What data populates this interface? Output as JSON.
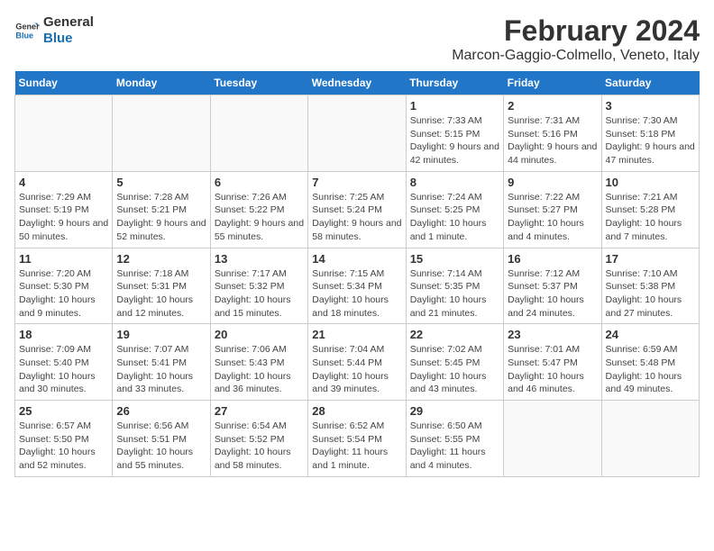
{
  "header": {
    "logo_line1": "General",
    "logo_line2": "Blue",
    "title": "February 2024",
    "subtitle": "Marcon-Gaggio-Colmello, Veneto, Italy"
  },
  "weekdays": [
    "Sunday",
    "Monday",
    "Tuesday",
    "Wednesday",
    "Thursday",
    "Friday",
    "Saturday"
  ],
  "weeks": [
    [
      {
        "day": "",
        "info": ""
      },
      {
        "day": "",
        "info": ""
      },
      {
        "day": "",
        "info": ""
      },
      {
        "day": "",
        "info": ""
      },
      {
        "day": "1",
        "info": "Sunrise: 7:33 AM\nSunset: 5:15 PM\nDaylight: 9 hours and 42 minutes."
      },
      {
        "day": "2",
        "info": "Sunrise: 7:31 AM\nSunset: 5:16 PM\nDaylight: 9 hours and 44 minutes."
      },
      {
        "day": "3",
        "info": "Sunrise: 7:30 AM\nSunset: 5:18 PM\nDaylight: 9 hours and 47 minutes."
      }
    ],
    [
      {
        "day": "4",
        "info": "Sunrise: 7:29 AM\nSunset: 5:19 PM\nDaylight: 9 hours and 50 minutes."
      },
      {
        "day": "5",
        "info": "Sunrise: 7:28 AM\nSunset: 5:21 PM\nDaylight: 9 hours and 52 minutes."
      },
      {
        "day": "6",
        "info": "Sunrise: 7:26 AM\nSunset: 5:22 PM\nDaylight: 9 hours and 55 minutes."
      },
      {
        "day": "7",
        "info": "Sunrise: 7:25 AM\nSunset: 5:24 PM\nDaylight: 9 hours and 58 minutes."
      },
      {
        "day": "8",
        "info": "Sunrise: 7:24 AM\nSunset: 5:25 PM\nDaylight: 10 hours and 1 minute."
      },
      {
        "day": "9",
        "info": "Sunrise: 7:22 AM\nSunset: 5:27 PM\nDaylight: 10 hours and 4 minutes."
      },
      {
        "day": "10",
        "info": "Sunrise: 7:21 AM\nSunset: 5:28 PM\nDaylight: 10 hours and 7 minutes."
      }
    ],
    [
      {
        "day": "11",
        "info": "Sunrise: 7:20 AM\nSunset: 5:30 PM\nDaylight: 10 hours and 9 minutes."
      },
      {
        "day": "12",
        "info": "Sunrise: 7:18 AM\nSunset: 5:31 PM\nDaylight: 10 hours and 12 minutes."
      },
      {
        "day": "13",
        "info": "Sunrise: 7:17 AM\nSunset: 5:32 PM\nDaylight: 10 hours and 15 minutes."
      },
      {
        "day": "14",
        "info": "Sunrise: 7:15 AM\nSunset: 5:34 PM\nDaylight: 10 hours and 18 minutes."
      },
      {
        "day": "15",
        "info": "Sunrise: 7:14 AM\nSunset: 5:35 PM\nDaylight: 10 hours and 21 minutes."
      },
      {
        "day": "16",
        "info": "Sunrise: 7:12 AM\nSunset: 5:37 PM\nDaylight: 10 hours and 24 minutes."
      },
      {
        "day": "17",
        "info": "Sunrise: 7:10 AM\nSunset: 5:38 PM\nDaylight: 10 hours and 27 minutes."
      }
    ],
    [
      {
        "day": "18",
        "info": "Sunrise: 7:09 AM\nSunset: 5:40 PM\nDaylight: 10 hours and 30 minutes."
      },
      {
        "day": "19",
        "info": "Sunrise: 7:07 AM\nSunset: 5:41 PM\nDaylight: 10 hours and 33 minutes."
      },
      {
        "day": "20",
        "info": "Sunrise: 7:06 AM\nSunset: 5:43 PM\nDaylight: 10 hours and 36 minutes."
      },
      {
        "day": "21",
        "info": "Sunrise: 7:04 AM\nSunset: 5:44 PM\nDaylight: 10 hours and 39 minutes."
      },
      {
        "day": "22",
        "info": "Sunrise: 7:02 AM\nSunset: 5:45 PM\nDaylight: 10 hours and 43 minutes."
      },
      {
        "day": "23",
        "info": "Sunrise: 7:01 AM\nSunset: 5:47 PM\nDaylight: 10 hours and 46 minutes."
      },
      {
        "day": "24",
        "info": "Sunrise: 6:59 AM\nSunset: 5:48 PM\nDaylight: 10 hours and 49 minutes."
      }
    ],
    [
      {
        "day": "25",
        "info": "Sunrise: 6:57 AM\nSunset: 5:50 PM\nDaylight: 10 hours and 52 minutes."
      },
      {
        "day": "26",
        "info": "Sunrise: 6:56 AM\nSunset: 5:51 PM\nDaylight: 10 hours and 55 minutes."
      },
      {
        "day": "27",
        "info": "Sunrise: 6:54 AM\nSunset: 5:52 PM\nDaylight: 10 hours and 58 minutes."
      },
      {
        "day": "28",
        "info": "Sunrise: 6:52 AM\nSunset: 5:54 PM\nDaylight: 11 hours and 1 minute."
      },
      {
        "day": "29",
        "info": "Sunrise: 6:50 AM\nSunset: 5:55 PM\nDaylight: 11 hours and 4 minutes."
      },
      {
        "day": "",
        "info": ""
      },
      {
        "day": "",
        "info": ""
      }
    ]
  ]
}
